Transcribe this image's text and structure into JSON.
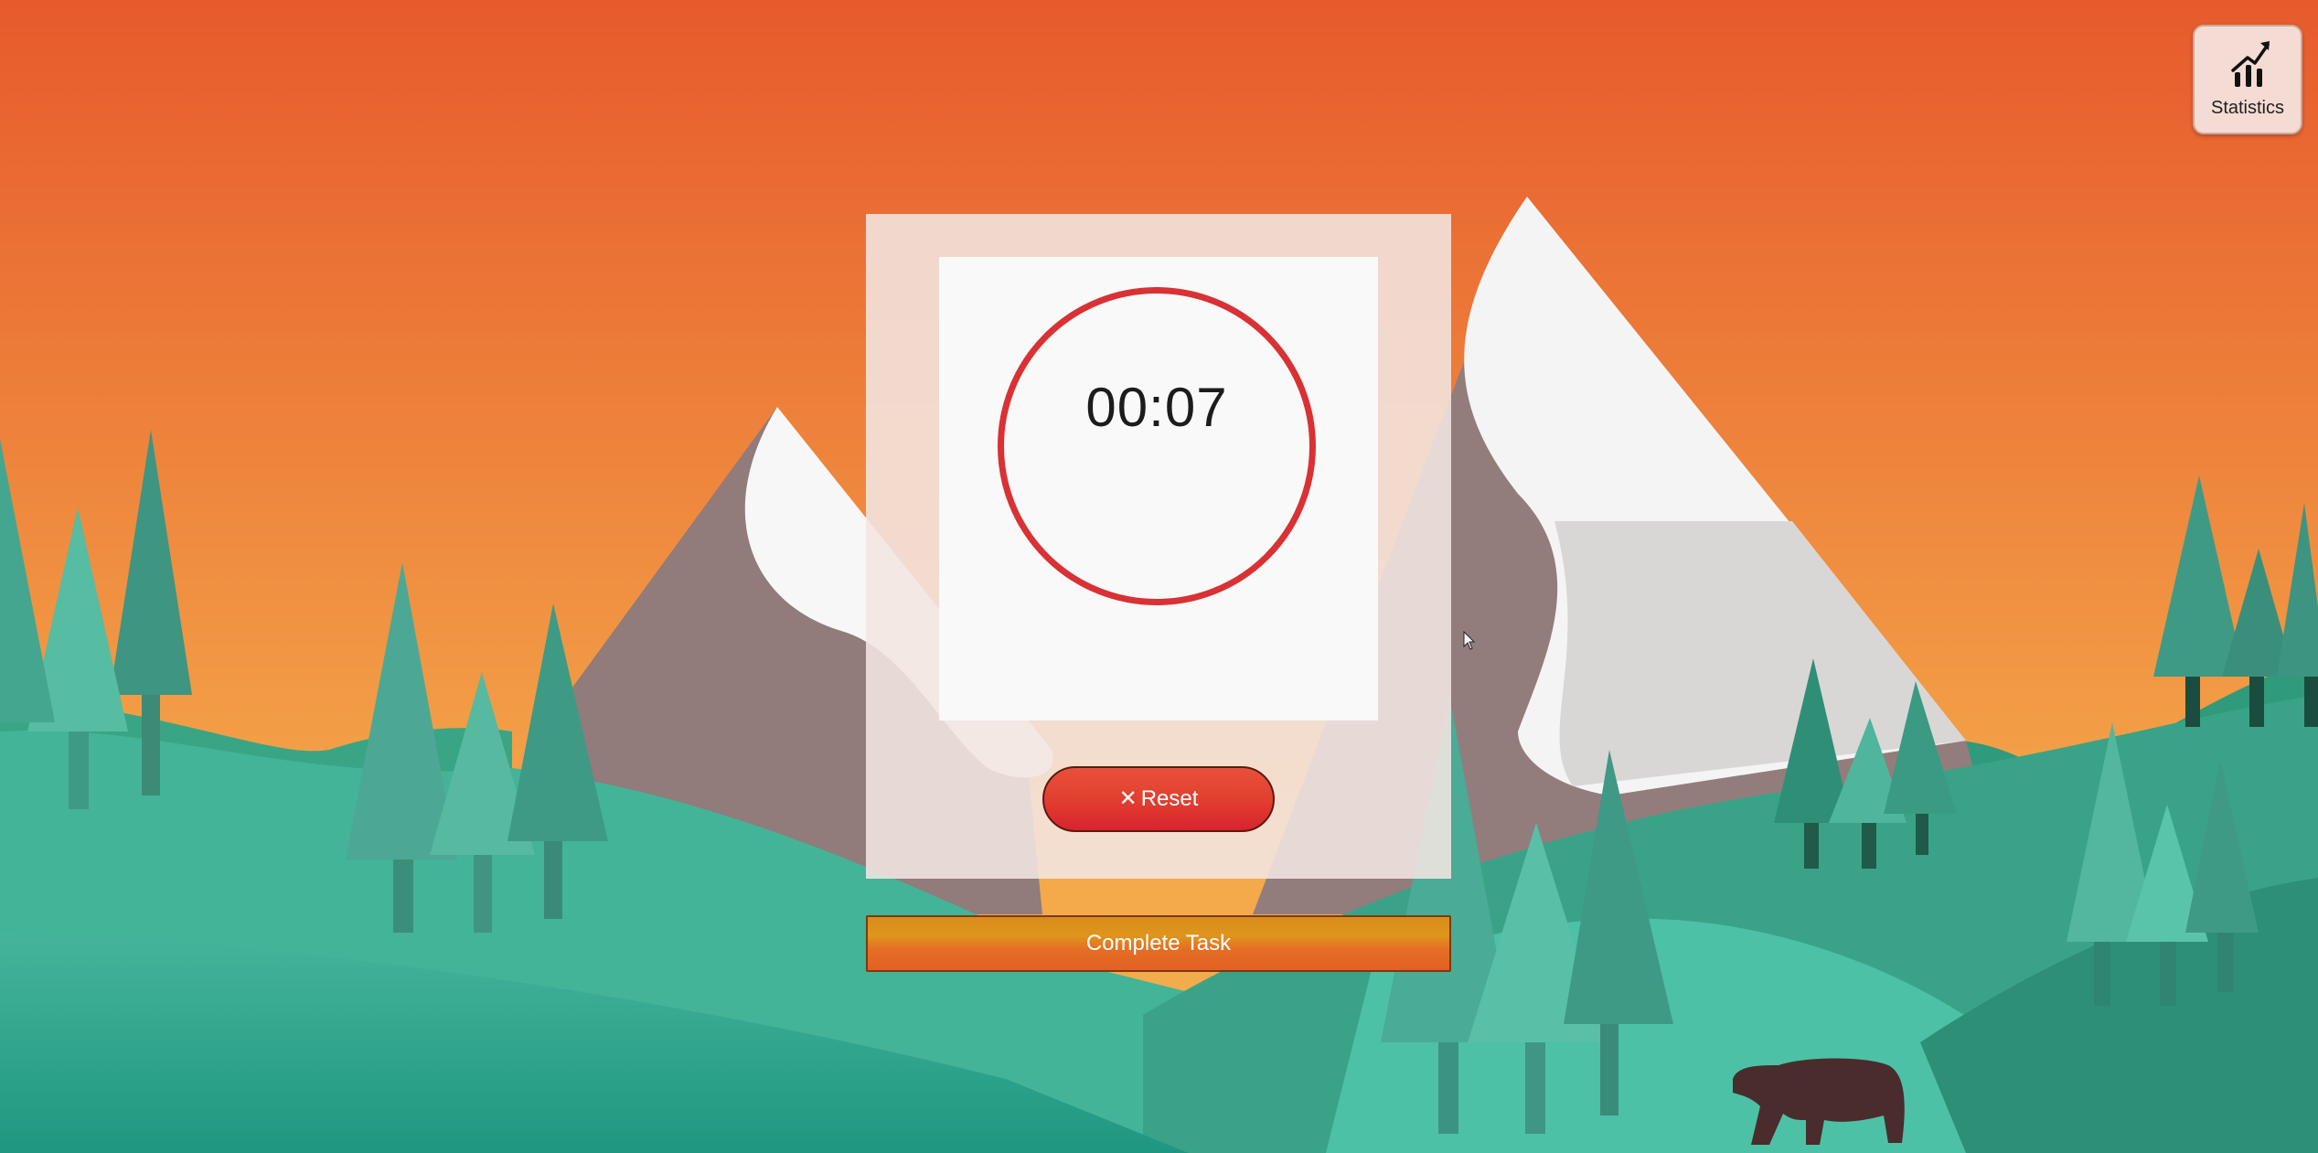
{
  "statistics_button": {
    "label": "Statistics",
    "icon": "bar-chart-trend-icon"
  },
  "timer": {
    "display": "00:07",
    "ring_color": "#d93134"
  },
  "reset_button": {
    "label": "Reset",
    "icon": "close-icon"
  },
  "complete_button": {
    "label": "Complete Task"
  },
  "colors": {
    "sky_top": "#e85a2c",
    "sky_bottom": "#f3a648",
    "hill": "#3aa88a",
    "mountain": "#8f7a7a",
    "snow": "#f5f5f5",
    "reset": "#e0392f",
    "complete": "#e0801f"
  }
}
